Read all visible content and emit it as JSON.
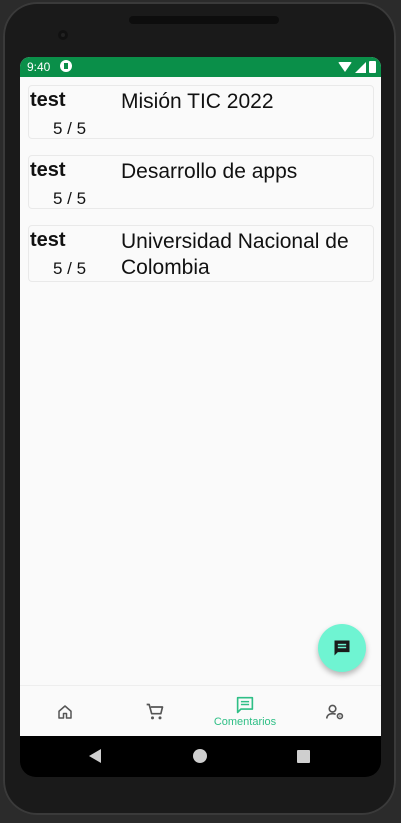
{
  "status_bar": {
    "time": "9:40"
  },
  "comments": [
    {
      "user": "test",
      "score": "5 / 5",
      "text": "Misión TIC 2022"
    },
    {
      "user": "test",
      "score": "5 / 5",
      "text": "Desarrollo de apps"
    },
    {
      "user": "test",
      "score": "5 / 5",
      "text": "Universidad Nacional de Colombia"
    }
  ],
  "bottom_nav": {
    "items": [
      {
        "icon": "home-icon",
        "label": ""
      },
      {
        "icon": "cart-icon",
        "label": ""
      },
      {
        "icon": "comments-icon",
        "label": "Comentarios"
      },
      {
        "icon": "user-settings-icon",
        "label": ""
      }
    ],
    "active_color": "#2fbf86"
  },
  "fab": {
    "icon": "comment-icon",
    "color": "#6ff4d2"
  },
  "colors": {
    "status_bar": "#0a8f49",
    "background": "#fafafa"
  }
}
